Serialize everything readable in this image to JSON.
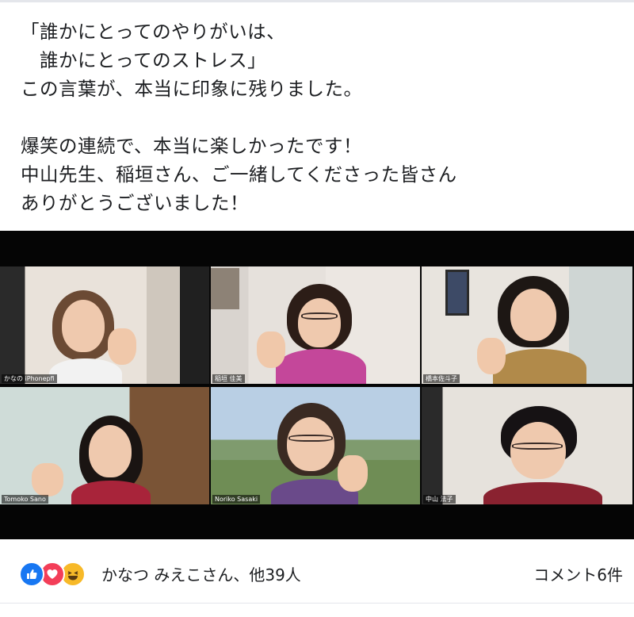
{
  "post": {
    "lines": [
      "「誰かにとってのやりがいは、",
      "　誰かにとってのストレス」",
      "この言葉が、本当に印象に残りました。",
      "",
      "爆笑の連続で、本当に楽しかったです！",
      "中山先生、稲垣さん、ご一緒してくださった皆さん",
      "ありがとうございました！"
    ]
  },
  "video_call": {
    "participants": [
      {
        "name": "かなの iPhonepfi",
        "active": true
      },
      {
        "name": "稲垣 佳美",
        "active": false
      },
      {
        "name": "橋本佐斗子",
        "active": false
      },
      {
        "name": "Tomoko Sano",
        "active": false
      },
      {
        "name": "Noriko Sasaki",
        "active": false
      },
      {
        "name": "中山 法子",
        "active": false
      }
    ]
  },
  "footer": {
    "reaction_icons": [
      "like-icon",
      "love-icon",
      "haha-icon"
    ],
    "reactions_text": "かなつ みえこさん、他39人",
    "comments_text": "コメント6件"
  },
  "colors": {
    "like": "#1877f2",
    "love": "#f33e58",
    "haha": "#f7b928",
    "active_speaker": "#b6d35a"
  }
}
